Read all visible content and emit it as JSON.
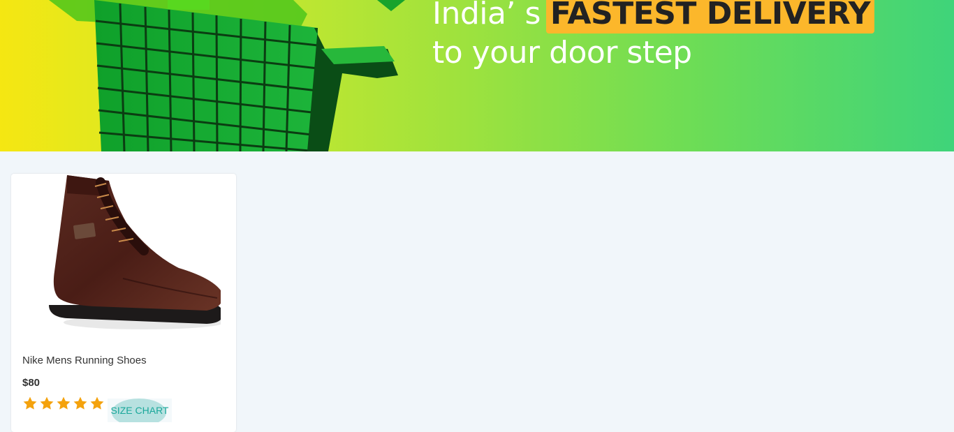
{
  "banner": {
    "headline_part1": "India’ s",
    "headline_highlight": "FASTEST DELIVERY",
    "headline_line2": "to your door step",
    "colors": {
      "gradient_start": "#f5e712",
      "gradient_end": "#3fd47a",
      "highlight": "#fcb72b"
    }
  },
  "product": {
    "name": "Nike Mens Running Shoes",
    "price": "$80",
    "rating": 5,
    "rating_max": 5,
    "size_chart_label": "SIZE CHART",
    "star_color": "#f4a20d",
    "accent_color": "#1aa79a"
  },
  "icons": {
    "star": "star-icon",
    "banner_art": "shopping-basket-icon",
    "product_image": "boot-icon"
  }
}
